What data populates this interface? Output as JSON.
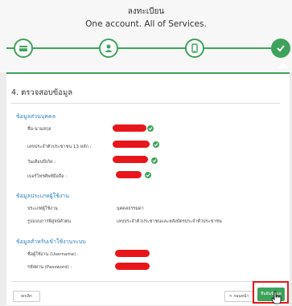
{
  "header": {
    "title": "ลงทะเบียน",
    "subtitle": "One account. All of Services."
  },
  "steps": [
    {
      "icon": "card-icon",
      "active": false
    },
    {
      "icon": "user-icon",
      "active": false
    },
    {
      "icon": "phone-icon",
      "active": false
    },
    {
      "icon": "check-icon",
      "active": true
    }
  ],
  "section": {
    "title": "4. ตรวจสอบข้อมูล"
  },
  "personal": {
    "heading": "ข้อมูลส่วนบุคคล",
    "rows": [
      {
        "label": "ชื่อ-นามสกุล"
      },
      {
        "label": "เลขประจำตัวประชาชน 13 หลัก :"
      },
      {
        "label": "วันเดือนปีเกิด :"
      },
      {
        "label": "เบอร์โทรศัพท์มือถือ :"
      }
    ]
  },
  "usertype": {
    "heading": "ข้อมูลประเภทผู้ใช้งาน",
    "rows": [
      {
        "label": "ประเภทผู้ใช้งาน",
        "value": "บุคคลธรรมดา"
      },
      {
        "label": "รูปแบบการพิสูจน์ตัวตน",
        "value": "เลขประจำตัวประชาชนและหลังบัตรประจำตัวประชาชน"
      }
    ]
  },
  "login": {
    "heading": "ข้อมูลสำหรับเข้าใช้งานระบบ",
    "rows": [
      {
        "label": "ชื่อผู้ใช้งาน (Username) :"
      },
      {
        "label": "รหัสผ่าน (Password) :"
      }
    ]
  },
  "buttons": {
    "cancel": "ยกเลิก",
    "back": "< ก่อนหน้า",
    "confirm": "ยืนยันข้อมูล"
  },
  "colors": {
    "accent": "#3da35a",
    "redaction": "#e8161b",
    "group_heading": "#2a7fc1"
  }
}
